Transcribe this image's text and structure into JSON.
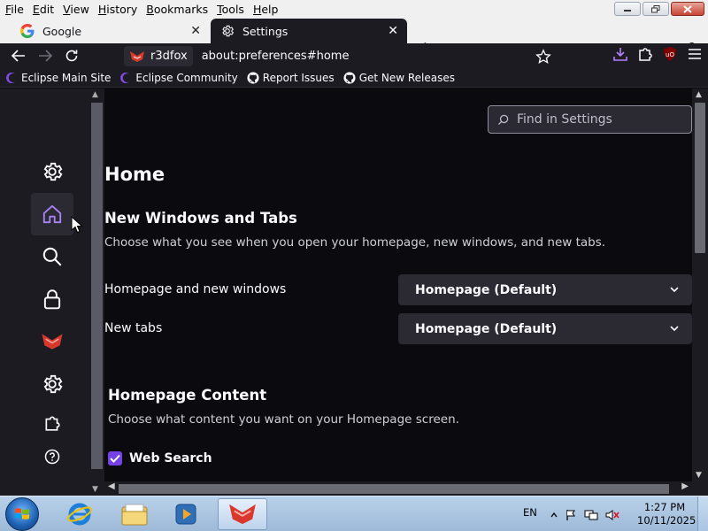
{
  "menubar": {
    "items": [
      {
        "label": "File",
        "accel": "F",
        "rest": "ile"
      },
      {
        "label": "Edit",
        "accel": "E",
        "rest": "dit"
      },
      {
        "label": "View",
        "accel": "V",
        "rest": "iew"
      },
      {
        "label": "History",
        "accel": "H",
        "rest": "istory"
      },
      {
        "label": "Bookmarks",
        "accel": "B",
        "rest": "ookmarks"
      },
      {
        "label": "Tools",
        "accel": "T",
        "rest": "ools"
      },
      {
        "label": "Help",
        "accel": "H",
        "rest": "elp"
      }
    ]
  },
  "tabs": {
    "google": {
      "label": "Google",
      "icon": "google-icon"
    },
    "settings": {
      "label": "Settings",
      "icon": "gear-icon"
    },
    "tab_count": "2"
  },
  "navbar": {
    "identity_label": "r3dfox",
    "url": "about:preferences#home"
  },
  "bookmarks": [
    {
      "label": "Eclipse Main Site",
      "icon": "eclipse-icon"
    },
    {
      "label": "Eclipse Community",
      "icon": "eclipse-icon"
    },
    {
      "label": "Report Issues",
      "icon": "github-icon"
    },
    {
      "label": "Get New Releases",
      "icon": "github-icon"
    }
  ],
  "sidebar": {
    "selected": "home",
    "items": [
      "general",
      "home",
      "search",
      "privacy",
      "r3dfox",
      "more-settings",
      "extensions",
      "help"
    ]
  },
  "settings": {
    "search_placeholder": "Find in Settings",
    "page_title": "Home",
    "new_windows": {
      "title": "New Windows and Tabs",
      "description": "Choose what you see when you open your homepage, new windows, and new tabs.",
      "homepage_label": "Homepage and new windows",
      "homepage_value": "Homepage (Default)",
      "newtabs_label": "New tabs",
      "newtabs_value": "Homepage (Default)"
    },
    "homepage_content": {
      "title": "Homepage Content",
      "description": "Choose what content you want on your Homepage screen.",
      "web_search_label": "Web Search",
      "web_search_checked": true
    }
  },
  "taskbar": {
    "language": "EN",
    "time": "1:27 PM",
    "date": "10/11/2025"
  },
  "colors": {
    "accent": "#7542e5",
    "background": "#1c1b22",
    "content_bg": "#0b0b0f"
  }
}
